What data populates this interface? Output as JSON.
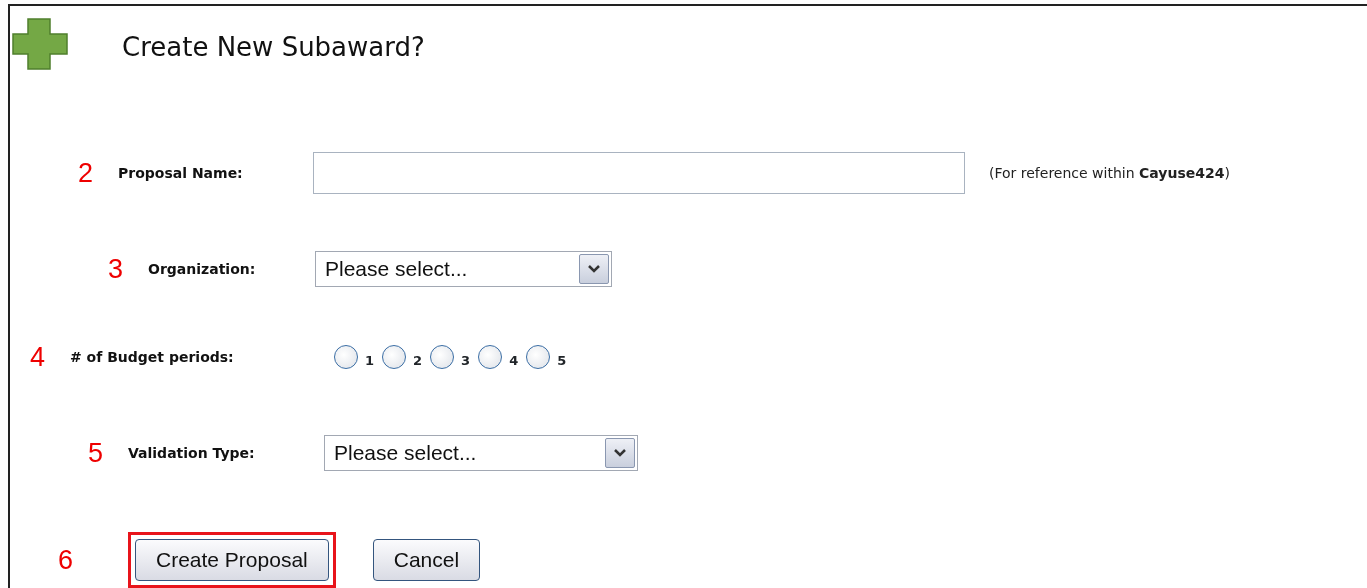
{
  "title": "Create New Subaward?",
  "fields": [
    {
      "kind": "text",
      "marker": "2",
      "label": "Proposal Name:",
      "note": "(For reference within **Cayuse424**)"
    },
    {
      "kind": "select",
      "marker": "3",
      "label": "Organization:",
      "value": "Please select..."
    },
    {
      "kind": "radio",
      "marker": "4",
      "label": "# of Budget periods:",
      "options": [
        {
          "label": "1",
          "selected": false
        },
        {
          "label": "2",
          "selected": false
        },
        {
          "label": "3",
          "selected": false
        },
        {
          "label": "4",
          "selected": false
        },
        {
          "label": "5",
          "selected": false
        }
      ]
    },
    {
      "kind": "select",
      "marker": "5",
      "label": "Validation Type:",
      "value": "Please select..."
    }
  ],
  "actions": {
    "marker": "6",
    "buttons": [
      {
        "label": "Create Proposal",
        "highlighted": true
      },
      {
        "label": "Cancel",
        "highlighted": false
      }
    ]
  }
}
